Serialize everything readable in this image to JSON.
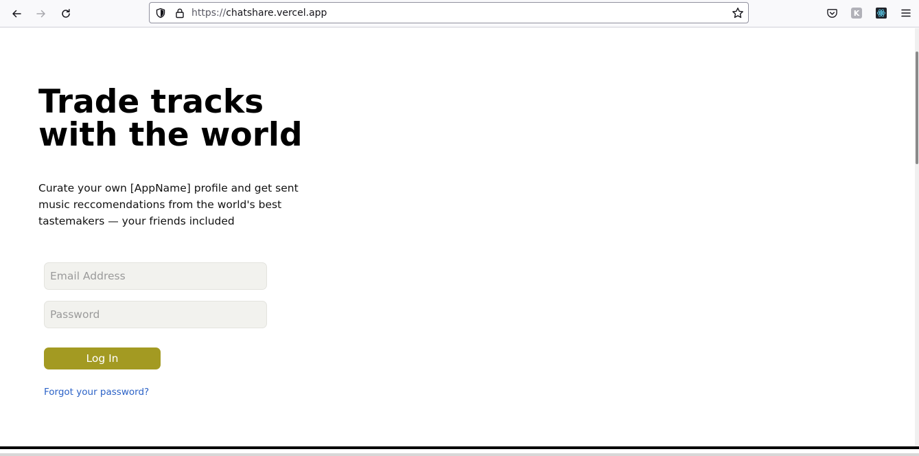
{
  "browser": {
    "url_scheme": "https://",
    "url_host": "chatshare.vercel.app",
    "back_icon": "arrow-left-icon",
    "forward_icon": "arrow-right-icon",
    "reload_icon": "reload-icon",
    "ext_k_label": "K"
  },
  "hero": {
    "headline_line1": "Trade tracks",
    "headline_line2": "with the world",
    "subline": "Curate your own [AppName] profile and get sent music reccomendations from the world's best tastemakers — your friends included"
  },
  "login": {
    "email_placeholder": "Email Address",
    "password_placeholder": "Password",
    "login_label": "Log In",
    "forgot_label": "Forgot your password?",
    "button_color": "#a39a22",
    "link_color": "#2b62c7"
  }
}
